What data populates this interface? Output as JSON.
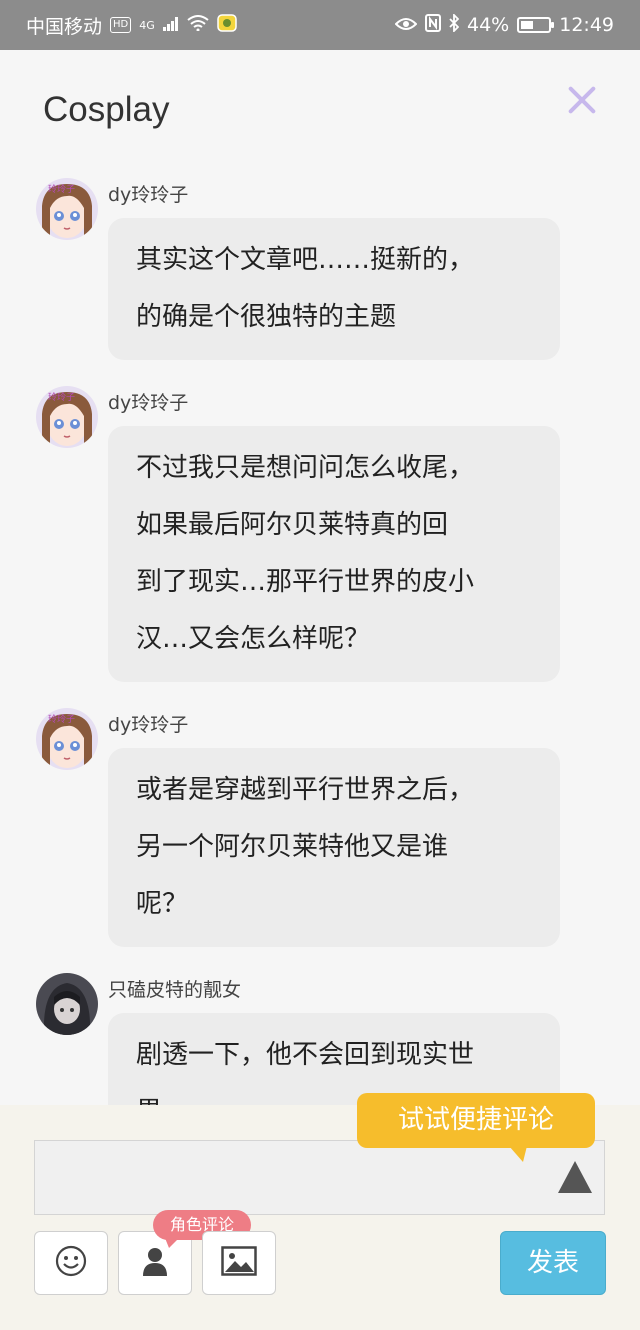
{
  "status_bar": {
    "carrier": "中国移动",
    "hd": "HD",
    "network": "4G",
    "battery": "44%",
    "battery_level": 0.44,
    "time": "12:49"
  },
  "header": {
    "title": "Cosplay"
  },
  "messages": [
    {
      "user": "dy玲玲子",
      "avatar": "anime-girl-avatar",
      "lines": [
        "其实这个文章吧……挺新的，",
        "的确是个很独特的主题"
      ]
    },
    {
      "user": "dy玲玲子",
      "avatar": "anime-girl-avatar",
      "lines": [
        "不过我只是想问问怎么收尾，",
        "如果最后阿尔贝莱特真的回",
        "到了现实…那平行世界的皮小",
        "汉…又会怎么样呢？"
      ]
    },
    {
      "user": "dy玲玲子",
      "avatar": "anime-girl-avatar",
      "lines": [
        "或者是穿越到平行世界之后，",
        "另一个阿尔贝莱特他又是谁",
        "呢？"
      ]
    },
    {
      "user": "只磕皮特的靓女",
      "avatar": "dark-hood-avatar",
      "lines": [
        "剧透一下，他不会回到现实世",
        "界"
      ]
    }
  ],
  "composer": {
    "quick_comment_tip": "试试便捷评论",
    "role_comment_tag": "角色评论",
    "post_label": "发表"
  },
  "colors": {
    "status_bar_bg": "#8c8c8c",
    "close_icon": "#c7b8ec",
    "tip_bg": "#f6bd2c",
    "role_tag_bg": "#ee7d85",
    "post_button_bg": "#57bde0"
  }
}
